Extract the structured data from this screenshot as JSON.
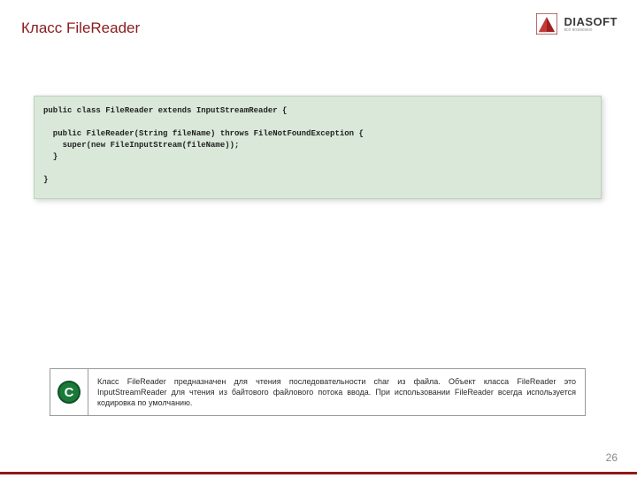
{
  "title": "Класс FileReader",
  "logo": {
    "text": "DIASOFT",
    "tagline": "всё возможно"
  },
  "code": "public class FileReader extends InputStreamReader {\n\n  public FileReader(String fileName) throws FileNotFoundException {\n    super(new FileInputStream(fileName));\n  }\n\n}",
  "note": {
    "icon_letter": "C",
    "text": "Класс FileReader предназначен для чтения последовательности char из файла. Объект класса FileReader это InputStreamReader для чтения из байтового файлового потока ввода. При использовании FileReader всегда используется кодировка по умолчанию."
  },
  "page_number": "26"
}
